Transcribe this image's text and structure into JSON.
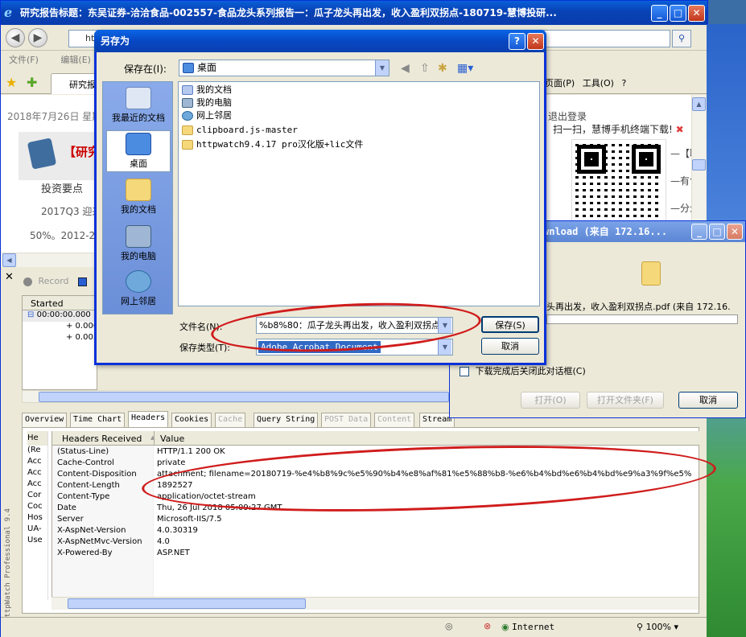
{
  "ie": {
    "title": "研究报告标题：东吴证券-洽洽食品-002557-食品龙头系列报告一：瓜子龙头再出发，收入盈利双拐点-180719-慧博投研...",
    "address_partial": "ht",
    "menu": [
      "文件(F)",
      "编辑(E)"
    ],
    "tab_label": "研究报",
    "toolbar_right": [
      "页面(P)",
      "工具(O)",
      "?"
    ],
    "status_zone": "Internet",
    "status_zoom": "100%"
  },
  "page": {
    "date": "2018年7月26日 星期",
    "banner_text": "【研究",
    "lines": [
      "投资要点",
      "2017Q3 迎来",
      "50%。2012-20"
    ],
    "logout": "退出登录",
    "qr_tip": "扫一扫，慧博手机终端下载!",
    "qr_close": "✖",
    "side_lines": [
      "—【联",
      "—有色",
      "—分众"
    ]
  },
  "httpwatch": {
    "close": "✕",
    "record": "Record",
    "vertical_label": "HttpWatch Professional 9.4",
    "grid_header": "Started",
    "grid_rows": [
      "00:00:00.000",
      "+ 0.000",
      "+ 0.005"
    ],
    "tabs": [
      {
        "label": "Overview",
        "disabled": false
      },
      {
        "label": "Time Chart",
        "disabled": false
      },
      {
        "label": "Headers",
        "disabled": false,
        "active": true
      },
      {
        "label": "Cookies",
        "disabled": false
      },
      {
        "label": "Cache",
        "disabled": true
      },
      {
        "label": "Query String",
        "disabled": false
      },
      {
        "label": "POST Data",
        "disabled": true
      },
      {
        "label": "Content",
        "disabled": true
      },
      {
        "label": "Stream",
        "disabled": false
      }
    ],
    "left_col_header": "He",
    "left_col": [
      "(Re",
      "Acc",
      "Acc",
      "Acc",
      "Cor",
      "Coc",
      "Hos",
      "UA-",
      "Use"
    ],
    "headers_title": "Headers Received",
    "value_title": "Value",
    "rows": [
      {
        "key": "(Status-Line)",
        "value": "HTTP/1.1 200 OK"
      },
      {
        "key": "Cache-Control",
        "value": "private"
      },
      {
        "key": "Content-Disposition",
        "value": "attachment; filename=20180719-%e4%b8%9c%e5%90%b4%e8%af%81%e5%88%b8-%e6%b4%bd%e6%b4%bd%e9%a3%9f%e5%"
      },
      {
        "key": "Content-Length",
        "value": "1892527"
      },
      {
        "key": "Content-Type",
        "value": "application/octet-stream"
      },
      {
        "key": "Date",
        "value": "Thu, 26 Jul 2018 05:09:27 GMT"
      },
      {
        "key": "Server",
        "value": "Microsoft-IIS/7.5"
      },
      {
        "key": "X-AspNet-Version",
        "value": "4.0.30319"
      },
      {
        "key": "X-AspNetMvc-Version",
        "value": "4.0"
      },
      {
        "key": "X-Powered-By",
        "value": "ASP.NET"
      }
    ]
  },
  "download": {
    "title": "wnload (来自 172.16...",
    "filename": "头再出发，收入盈利双拐点.pdf (来自 172.16.",
    "close_when_done": "下载完成后关闭此对话框(C)",
    "open": "打开(O)",
    "open_folder": "打开文件夹(F)",
    "cancel": "取消"
  },
  "save_as": {
    "title": "另存为",
    "save_in_label": "保存在(I):",
    "save_in_value": "桌面",
    "places": [
      "我最近的文档",
      "桌面",
      "我的文档",
      "我的电脑",
      "网上邻居"
    ],
    "files": [
      "我的文档",
      "我的电脑",
      "网上邻居",
      "clipboard.js-master",
      "httpwatch9.4.17 pro汉化版+lic文件"
    ],
    "filename_label": "文件名(N):",
    "filename_value": "%b8%80：瓜子龙头再出发，收入盈利双拐点",
    "filetype_label": "保存类型(T):",
    "filetype_value": "Adobe Acrobat Document",
    "save": "保存(S)",
    "cancel": "取消"
  }
}
